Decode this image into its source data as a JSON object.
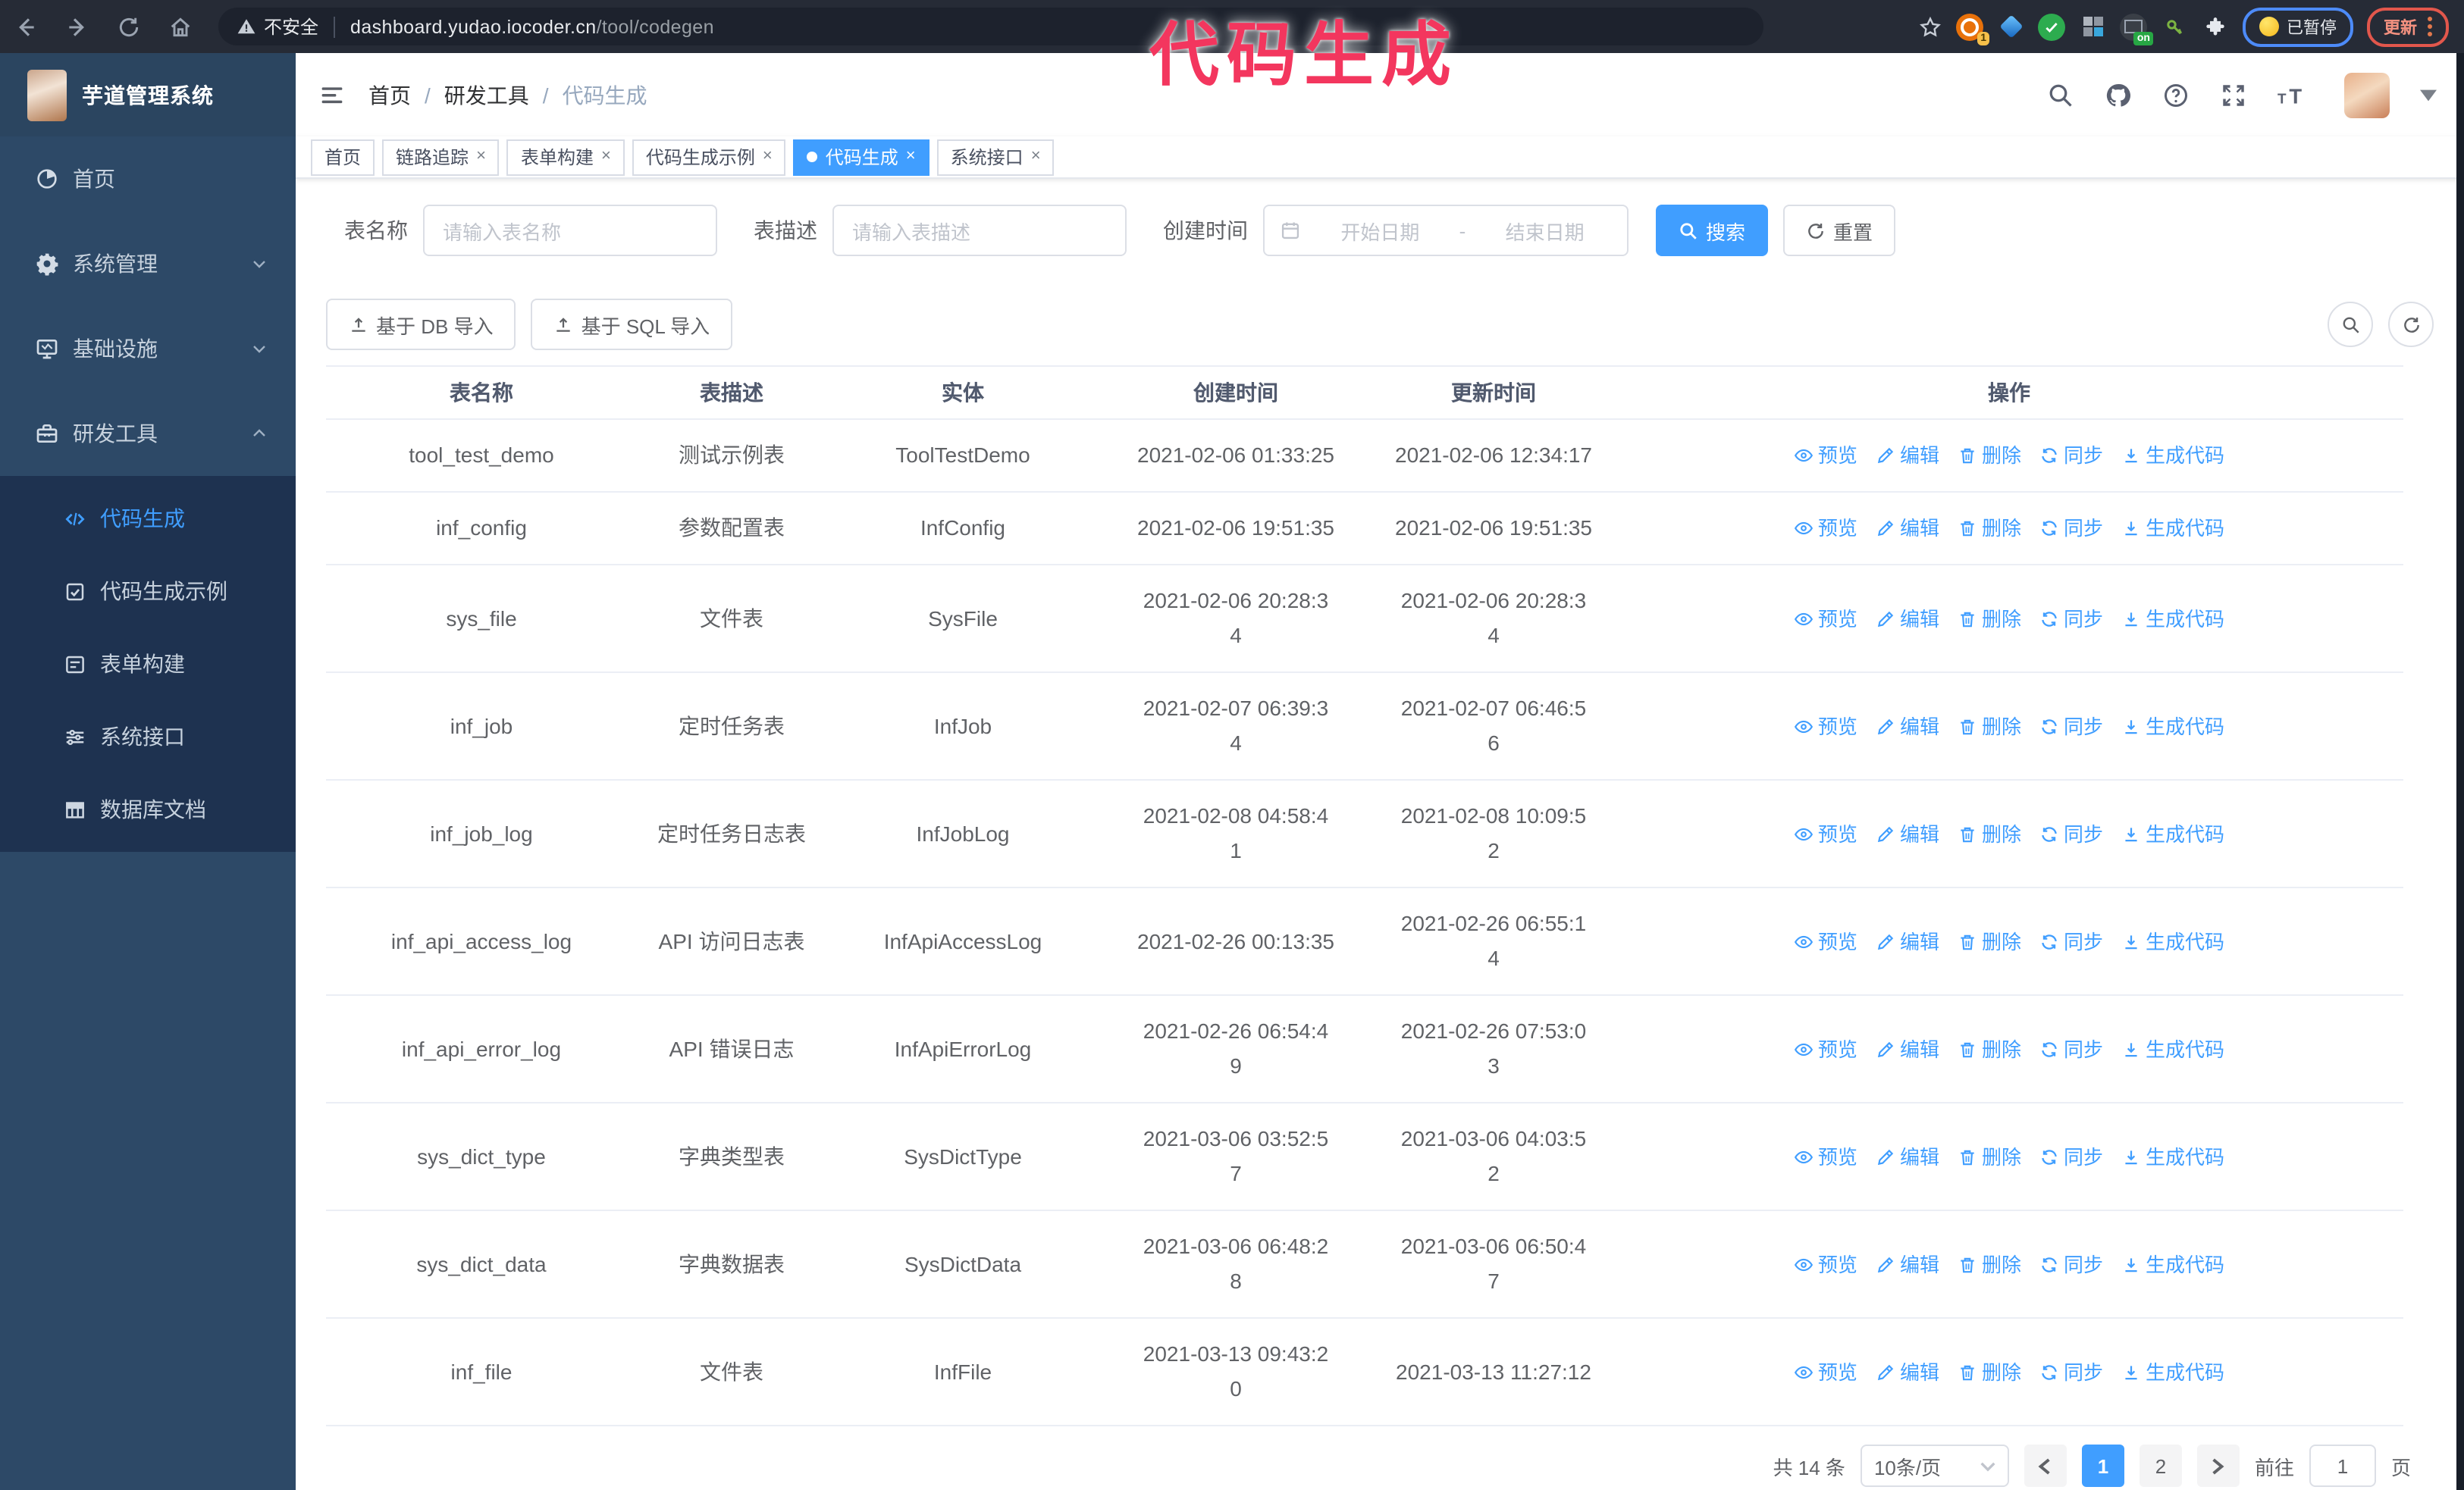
{
  "colors": {
    "accent": "#409eff",
    "annotation": "#f3365e",
    "sidebar_bg": "#2d4967",
    "submenu_bg": "#1e3250"
  },
  "chrome": {
    "security_label": "不安全",
    "url_host": "dashboard.yudao.iocoder.cn",
    "url_path": "/tool/codegen",
    "ext_badge": "1",
    "ext_on_badge": "on",
    "paused_label": "已暂停",
    "update_label": "更新"
  },
  "annotation": {
    "text": "代码生成"
  },
  "sidebar": {
    "title": "芋道管理系统",
    "menu": [
      {
        "label": "首页"
      },
      {
        "label": "系统管理",
        "arrow": "down"
      },
      {
        "label": "基础设施",
        "arrow": "down"
      },
      {
        "label": "研发工具",
        "arrow": "up"
      }
    ],
    "submenu": [
      {
        "label": "代码生成",
        "active": true
      },
      {
        "label": "代码生成示例"
      },
      {
        "label": "表单构建"
      },
      {
        "label": "系统接口"
      },
      {
        "label": "数据库文档"
      }
    ]
  },
  "navbar": {
    "breadcrumb": {
      "home": "首页",
      "group": "研发工具",
      "current": "代码生成"
    }
  },
  "tabs": [
    {
      "label": "首页"
    },
    {
      "label": "链路追踪"
    },
    {
      "label": "表单构建"
    },
    {
      "label": "代码生成示例"
    },
    {
      "label": "代码生成"
    },
    {
      "label": "系统接口"
    }
  ],
  "filters": {
    "table_name_label": "表名称",
    "table_name_placeholder": "请输入表名称",
    "table_desc_label": "表描述",
    "table_desc_placeholder": "请输入表描述",
    "create_time_label": "创建时间",
    "date_start_placeholder": "开始日期",
    "date_separator": "-",
    "date_end_placeholder": "结束日期",
    "search_button": "搜索",
    "reset_button": "重置"
  },
  "toolbar": {
    "import_db": "基于 DB 导入",
    "import_sql": "基于 SQL 导入"
  },
  "table": {
    "columns": [
      "表名称",
      "表描述",
      "实体",
      "创建时间",
      "更新时间",
      "操作"
    ],
    "actions": [
      "预览",
      "编辑",
      "删除",
      "同步",
      "生成代码"
    ],
    "rows": [
      {
        "name": "tool_test_demo",
        "desc": "测试示例表",
        "entity": "ToolTestDemo",
        "created": "2021-02-06 01:33:25",
        "updated": "2021-02-06 12:34:17"
      },
      {
        "name": "inf_config",
        "desc": "参数配置表",
        "entity": "InfConfig",
        "created": "2021-02-06 19:51:35",
        "updated": "2021-02-06 19:51:35"
      },
      {
        "name": "sys_file",
        "desc": "文件表",
        "entity": "SysFile",
        "created": "2021-02-06 20:28:3\n4",
        "updated": "2021-02-06 20:28:3\n4"
      },
      {
        "name": "inf_job",
        "desc": "定时任务表",
        "entity": "InfJob",
        "created": "2021-02-07 06:39:3\n4",
        "updated": "2021-02-07 06:46:5\n6"
      },
      {
        "name": "inf_job_log",
        "desc": "定时任务日志表",
        "entity": "InfJobLog",
        "created": "2021-02-08 04:58:4\n1",
        "updated": "2021-02-08 10:09:5\n2"
      },
      {
        "name": "inf_api_access_log",
        "desc": "API 访问日志表",
        "entity": "InfApiAccessLog",
        "created": "2021-02-26 00:13:35",
        "updated": "2021-02-26 06:55:1\n4"
      },
      {
        "name": "inf_api_error_log",
        "desc": "API 错误日志",
        "entity": "InfApiErrorLog",
        "created": "2021-02-26 06:54:4\n9",
        "updated": "2021-02-26 07:53:0\n3"
      },
      {
        "name": "sys_dict_type",
        "desc": "字典类型表",
        "entity": "SysDictType",
        "created": "2021-03-06 03:52:5\n7",
        "updated": "2021-03-06 04:03:5\n2"
      },
      {
        "name": "sys_dict_data",
        "desc": "字典数据表",
        "entity": "SysDictData",
        "created": "2021-03-06 06:48:2\n8",
        "updated": "2021-03-06 06:50:4\n7"
      },
      {
        "name": "inf_file",
        "desc": "文件表",
        "entity": "InfFile",
        "created": "2021-03-13 09:43:2\n0",
        "updated": "2021-03-13 11:27:12"
      }
    ]
  },
  "pagination": {
    "total": "共 14 条",
    "page_size": "10条/页",
    "pages": [
      "1",
      "2"
    ],
    "current_page": "1",
    "goto_label": "前往",
    "goto_value": "1",
    "unit": "页"
  }
}
